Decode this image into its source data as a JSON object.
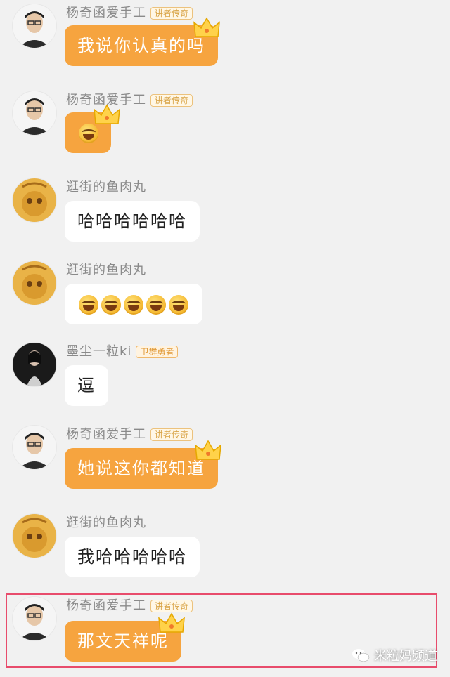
{
  "messages": [
    {
      "sender": "杨奇函爱手工",
      "badge": "讲者传奇",
      "text": "我说你认真的吗",
      "style": "orange"
    },
    {
      "sender": "杨奇函爱手工",
      "badge": "讲者传奇",
      "text": "",
      "style": "orange",
      "emoji": "laugh-cry-emoji"
    },
    {
      "sender": "逛街的鱼肉丸",
      "badge": "",
      "text": "哈哈哈哈哈哈",
      "style": "white"
    },
    {
      "sender": "逛街的鱼肉丸",
      "badge": "",
      "text": "",
      "style": "white",
      "emoji_count": 5
    },
    {
      "sender": "墨尘一粒ki",
      "badge": "卫群勇者",
      "text": "逗",
      "style": "white"
    },
    {
      "sender": "杨奇函爱手工",
      "badge": "讲者传奇",
      "text": "她说这你都知道",
      "style": "orange"
    },
    {
      "sender": "逛街的鱼肉丸",
      "badge": "",
      "text": "我哈哈哈哈哈",
      "style": "white"
    },
    {
      "sender": "杨奇函爱手工",
      "badge": "讲者传奇",
      "text": "那文天祥呢",
      "style": "orange"
    }
  ],
  "watermark": "米粒妈频道",
  "colors": {
    "orange_bubble": "#f6a43f",
    "white_bubble": "#ffffff",
    "highlight": "#e84c6c",
    "background": "#f1f1f1"
  }
}
